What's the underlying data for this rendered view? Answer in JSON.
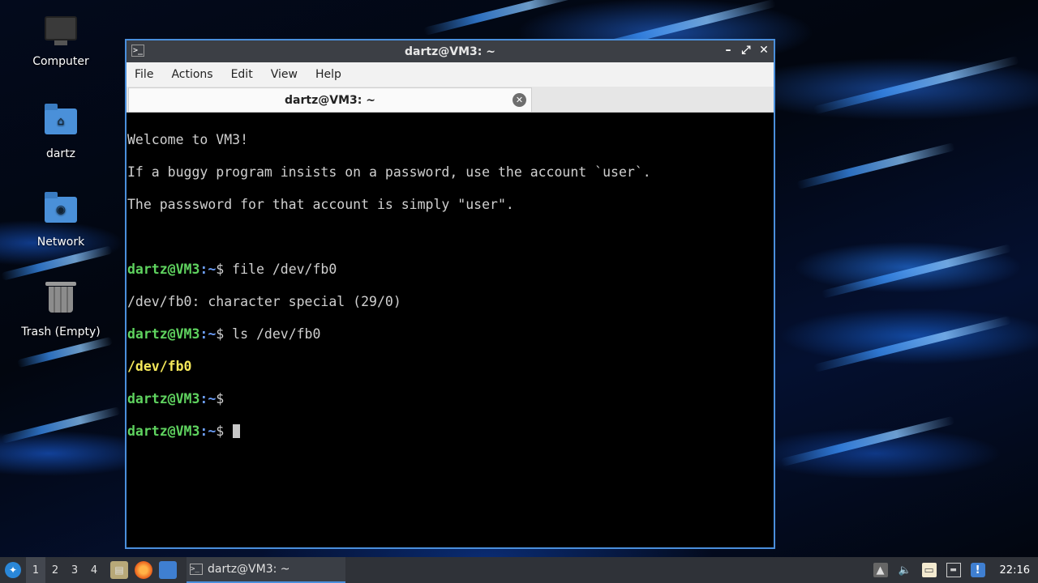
{
  "desktop": {
    "icons": [
      {
        "label": "Computer",
        "icon": "computer-icon"
      },
      {
        "label": "dartz",
        "icon": "home-folder-icon"
      },
      {
        "label": "Network",
        "icon": "network-folder-icon"
      },
      {
        "label": "Trash (Empty)",
        "icon": "trash-icon"
      }
    ]
  },
  "window": {
    "title": "dartz@VM3: ~",
    "menu": [
      "File",
      "Actions",
      "Edit",
      "View",
      "Help"
    ],
    "tab_label": "dartz@VM3: ~",
    "accent_color": "#4a8fdc"
  },
  "terminal": {
    "welcome": [
      "Welcome to VM3!",
      "If a buggy program insists on a password, use the account `user`.",
      "The passsword for that account is simply \"user\"."
    ],
    "prompt_user": "dartz@VM3",
    "prompt_path": ":~",
    "prompt_symbol": "$",
    "cmd1": " file /dev/fb0",
    "out1": "/dev/fb0: character special (29/0)",
    "cmd2": " ls /dev/fb0",
    "out2": "/dev/fb0",
    "colors": {
      "user": "#5fd35f",
      "path": "#6c9ef8",
      "highlight": "#f5e85a"
    }
  },
  "taskbar": {
    "workspaces": [
      "1",
      "2",
      "3",
      "4"
    ],
    "active_workspace": "1",
    "task_label": "dartz@VM3: ~",
    "clock": "22:16",
    "launchers": [
      "file-manager-icon",
      "firefox-icon",
      "desktop-icon"
    ],
    "tray": [
      "up-arrow-icon",
      "volume-icon",
      "clipboard-icon",
      "network-icon",
      "update-icon"
    ]
  }
}
